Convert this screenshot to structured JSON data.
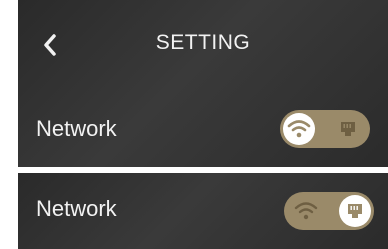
{
  "header": {
    "title": "SETTING",
    "back_icon": "chevron-left-icon"
  },
  "rows": [
    {
      "label": "Network",
      "selected": "wifi",
      "options": [
        "wifi-icon",
        "ethernet-icon"
      ]
    },
    {
      "label": "Network",
      "selected": "ethernet",
      "options": [
        "wifi-icon",
        "ethernet-icon"
      ]
    }
  ],
  "colors": {
    "background": "#2f2f2f",
    "text": "#f2f2f2",
    "toggle_track": "#9a8a69",
    "knob": "#ffffff",
    "icon_on_track": "#6e5f42"
  }
}
